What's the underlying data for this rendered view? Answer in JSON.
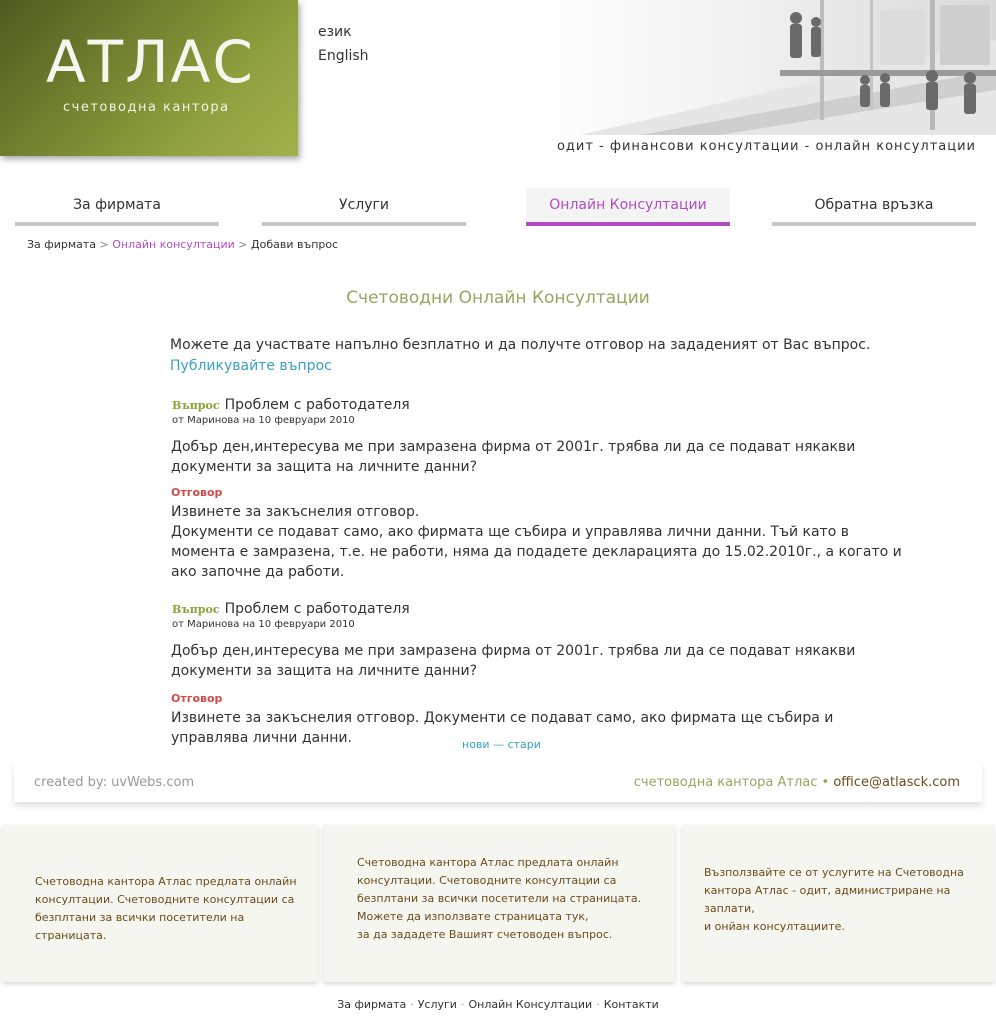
{
  "logo": {
    "title": "АТЛАС",
    "subtitle": "счетоводна кантора"
  },
  "language": {
    "label": "език",
    "option": "English"
  },
  "tagline": "одит - финансови консултации - онлайн консултации",
  "nav": [
    {
      "label": "За фирмата"
    },
    {
      "label": "Услуги"
    },
    {
      "label": "Онлайн Консултации"
    },
    {
      "label": "Обратна връзка"
    }
  ],
  "breadcrumb": {
    "home": "За фирмата",
    "section": "Онлайн консултации",
    "current": "Добави въпрос",
    "sep": ">"
  },
  "page_title": "Счетоводни Онлайн Консултации",
  "intro": "Можете да участвате напълно безплатно и да получте отговор на зададеният от Вас въпрос.",
  "publish_link": "Публикувайте въпрос",
  "entries": [
    {
      "q_label": "Въпрос",
      "title": "Проблем с работодателя",
      "meta": "от Маринова  на 10 февруари 2010",
      "question": "Добър ден,интересува ме при замразена фирма от 2001г. трябва ли да се подават някакви документи за защита на личните данни?",
      "a_label": "Отговор",
      "answer_line1": "Извинете за закъснелия отговор.",
      "answer_line2": "Документи се подават само, ако фирмата ще събира и управлява лични данни.  Тъй като в момента е замразена, т.е. не работи, няма да подадете декларацията до 15.02.2010г., а когато и ако започне да работи."
    },
    {
      "q_label": "Въпрос",
      "title": "Проблем с работодателя",
      "meta": "от Маринова  на 10 февруари 2010",
      "question": "Добър ден,интересува ме при замразена фирма от 2001г. трябва ли да се подават някакви документи за защита на личните данни?",
      "a_label": "Отговор",
      "answer_line1": "Извинете за закъснелия отговор.  Документи се подават само, ако фирмата ще събира и управлява лични данни."
    }
  ],
  "pager": {
    "newer": "нови",
    "dash": "—",
    "older": "стари"
  },
  "footer": {
    "credit": "created by: uvWebs.com",
    "company": "счетоводна кантора Атлас",
    "bullet": "•",
    "email": "office@atlasck.com"
  },
  "boxes": [
    {
      "lines": [
        "Счетоводна кантора Атлас предлата онлайн",
        "консултации. Счетоводните консултации са",
        "безплтани за всички посетители на страницата."
      ]
    },
    {
      "lines": [
        "Счетоводна кантора Атлас предлата онлайн",
        "консултации. Счетоводните консултации са",
        "безплтани за всички посетители на страницата.",
        "Можете да използвате страницата тук,",
        "за да зададете Вашият счетоводен въпрос."
      ]
    },
    {
      "lines": [
        "Възползвайте се от услугите на Счетоводна",
        "кантора Атлас - одит, администриране на",
        "заплати,",
        "и онйан консултациите."
      ]
    }
  ],
  "bottom_nav": [
    "За фирмата",
    "Услуги",
    "Онлайн Консултации",
    "Контакти"
  ],
  "bottom_nav_sep": "·",
  "colors": {
    "brand_green": "#8fa03e",
    "accent_purple": "#b04ec0",
    "link_blue": "#3aa0c6",
    "answer_red": "#d04a4a"
  }
}
